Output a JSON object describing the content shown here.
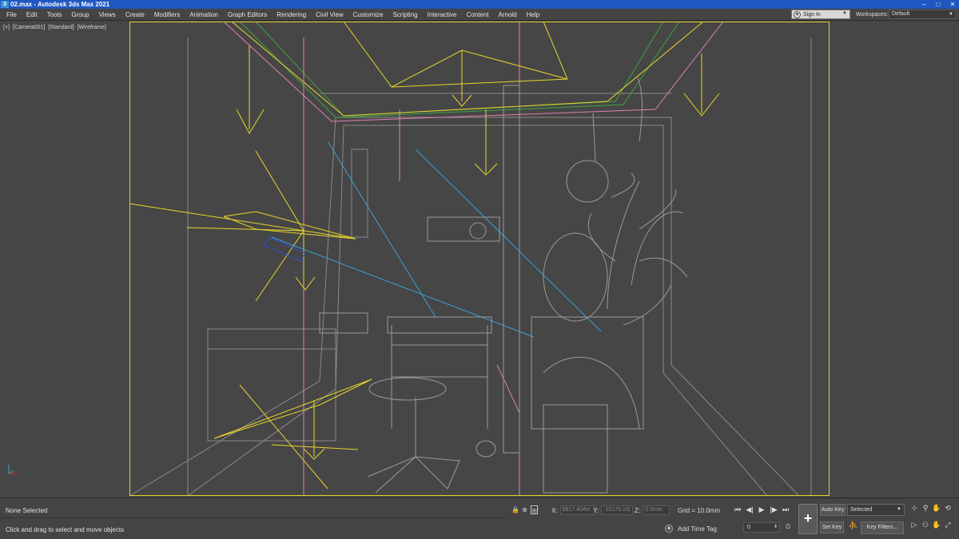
{
  "titlebar": {
    "app_icon_letter": "3",
    "title": "02.max - Autodesk 3ds Max 2021",
    "minimize": "–",
    "maximize": "□",
    "close": "✕"
  },
  "menu": {
    "items": [
      "File",
      "Edit",
      "Tools",
      "Group",
      "Views",
      "Create",
      "Modifiers",
      "Animation",
      "Graph Editors",
      "Rendering",
      "Civil View",
      "Customize",
      "Scripting",
      "Interactive",
      "Content",
      "Arnold",
      "Help"
    ],
    "signin_label": "Sign In",
    "workspaces_label": "Workspaces:",
    "workspace_value": "Default"
  },
  "viewport": {
    "label_parts": [
      "[+]",
      "[Camera001]",
      "[Standard]",
      "[Wireframe]"
    ],
    "safe_frame_color": "#e5d22a",
    "wire_colors": {
      "geometry": "#8c8c8c",
      "lights": "#e8d52b",
      "targets": "#3aa0d8",
      "pink": "#e07fb5",
      "green": "#3fa33f",
      "blue": "#2a52d6"
    }
  },
  "status": {
    "selection": "None Selected",
    "prompt": "Click and drag to select and move objects",
    "x_label": "X:",
    "x_value": "6917.404m",
    "y_label": "Y:",
    "y_value": "-10179.10(",
    "z_label": "Z:",
    "z_value": "0.0mm",
    "grid": "Grid = 10.0mm",
    "add_time_tag": "Add Time Tag"
  },
  "animation": {
    "auto_key": "Auto Key",
    "set_key": "Set Key",
    "selected_set": "Selected",
    "key_filters": "Key Filters...",
    "frame": "0"
  }
}
